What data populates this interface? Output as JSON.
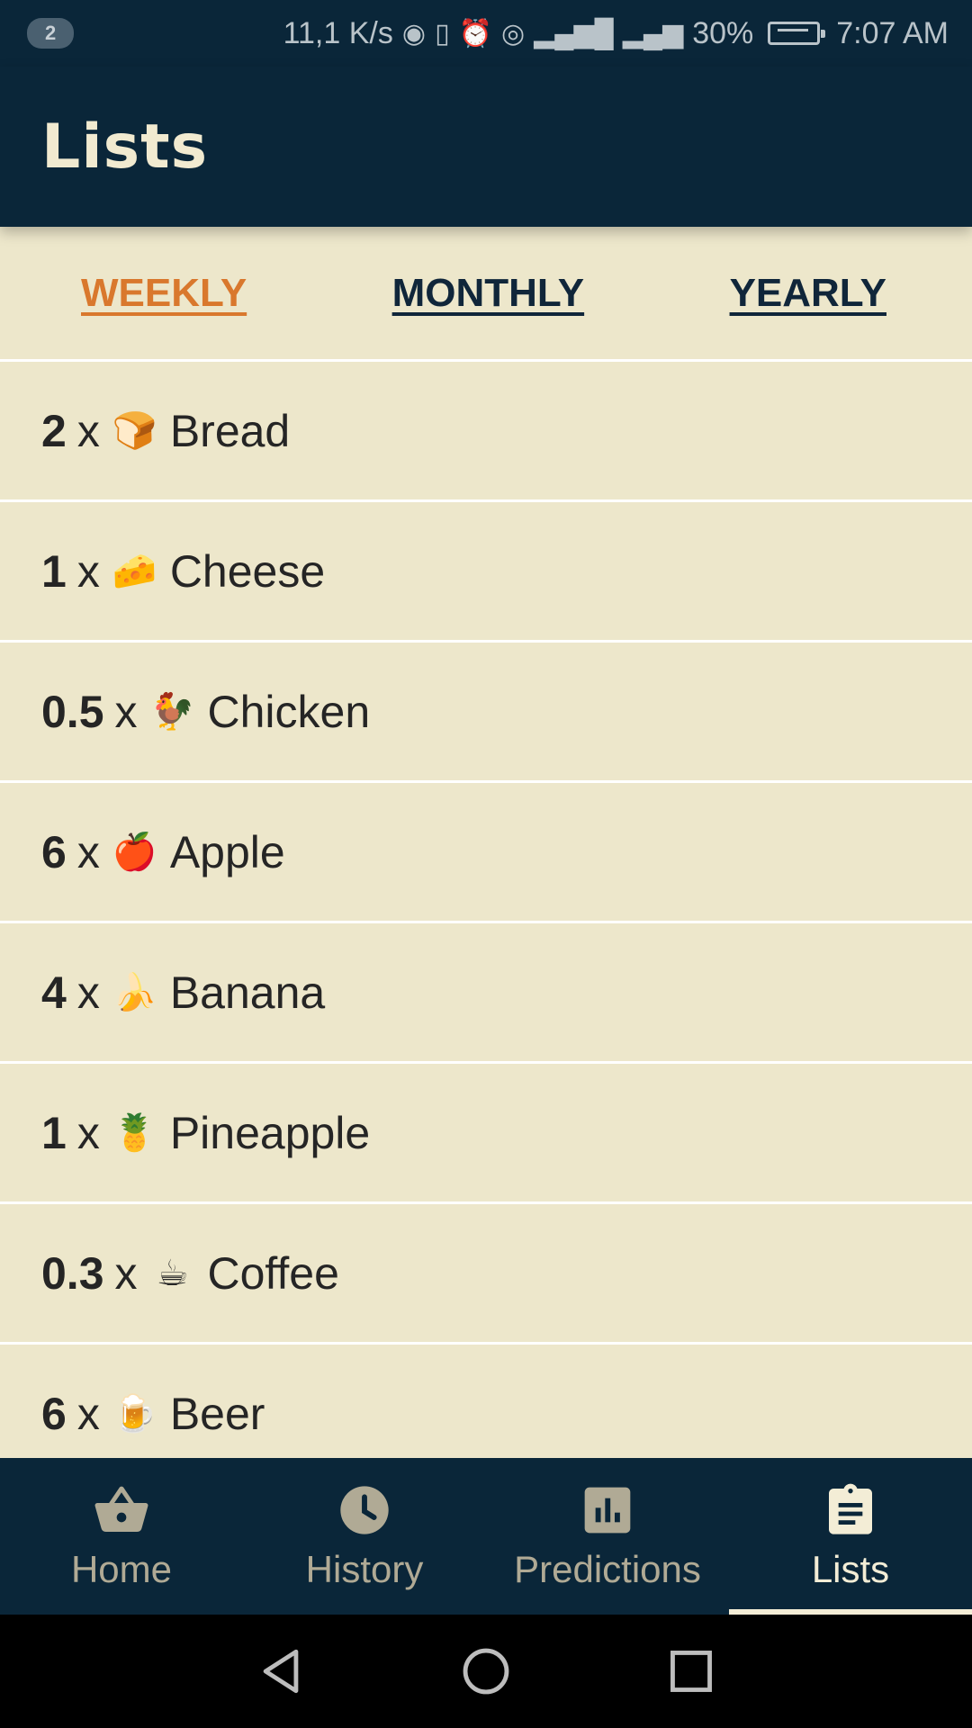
{
  "status_bar": {
    "notification_count": "2",
    "net_speed": "11,1 K/s",
    "battery": "30%",
    "time": "7:07 AM"
  },
  "app_bar": {
    "title": "Lists"
  },
  "tabs": [
    {
      "label": "WEEKLY",
      "active": true
    },
    {
      "label": "MONTHLY",
      "active": false
    },
    {
      "label": "YEARLY",
      "active": false
    }
  ],
  "items": [
    {
      "qty": "2",
      "emoji": "🍞",
      "name": "Bread"
    },
    {
      "qty": "1",
      "emoji": "🧀",
      "name": "Cheese"
    },
    {
      "qty": "0.5",
      "emoji": "🐓",
      "name": "Chicken"
    },
    {
      "qty": "6",
      "emoji": "🍎",
      "name": "Apple"
    },
    {
      "qty": "4",
      "emoji": "🍌",
      "name": "Banana"
    },
    {
      "qty": "1",
      "emoji": "🍍",
      "name": "Pineapple"
    },
    {
      "qty": "0.3",
      "emoji": "☕",
      "name": "Coffee"
    },
    {
      "qty": "6",
      "emoji": "🍺",
      "name": "Beer"
    }
  ],
  "multiplier": "x",
  "bottom_nav": [
    {
      "label": "Home",
      "icon": "basket-icon",
      "active": false
    },
    {
      "label": "History",
      "icon": "clock-icon",
      "active": false
    },
    {
      "label": "Predictions",
      "icon": "bar-chart-icon",
      "active": false
    },
    {
      "label": "Lists",
      "icon": "clipboard-icon",
      "active": true
    }
  ],
  "colors": {
    "primary": "#0a2639",
    "background": "#ede7cb",
    "accent": "#d9782d"
  }
}
